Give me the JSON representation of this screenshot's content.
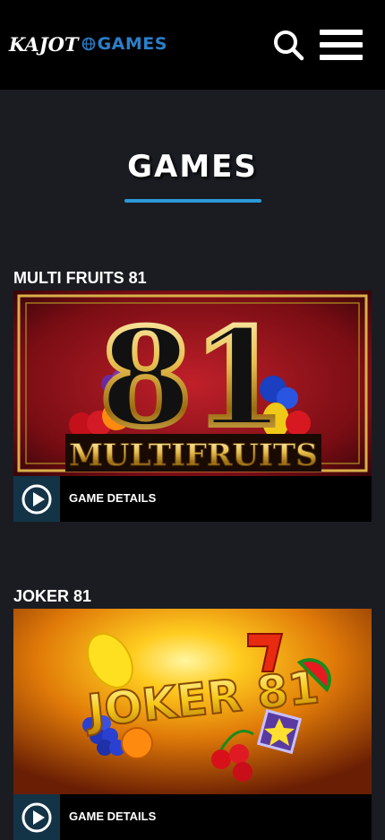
{
  "header": {
    "logo_part1": "KAJOT",
    "logo_part2": "GAMES",
    "icons": [
      "globe-icon",
      "search-icon",
      "hamburger-menu-icon"
    ]
  },
  "page": {
    "title": "GAMES",
    "accent_color": "#2b9ad6"
  },
  "games": [
    {
      "title": "MULTI FRUITS 81",
      "image_number": "81",
      "image_text": "MULTIFRUITS",
      "details_label": "GAME DETAILS",
      "icon": "play-circle-icon"
    },
    {
      "title": "JOKER 81",
      "image_text": "JOKER 81",
      "details_label": "GAME DETAILS",
      "icon": "play-circle-icon"
    }
  ]
}
